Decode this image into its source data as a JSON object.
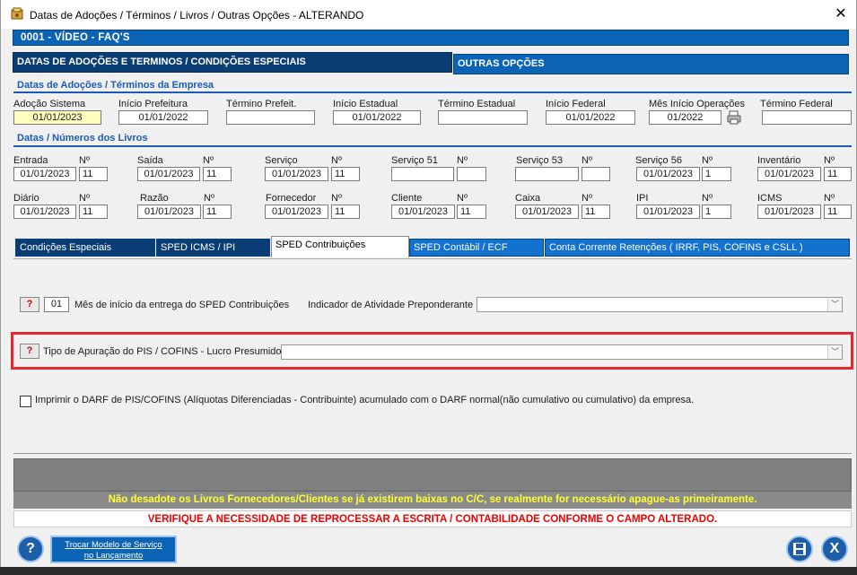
{
  "window": {
    "title": "Datas de Adoções / Términos / Livros / Outras Opções   -   ALTERANDO",
    "close": "✕"
  },
  "header": {
    "text": "0001   -   VÍDEO - FAQ'S"
  },
  "tabs": {
    "main_active": "DATAS DE ADOÇÕES E TERMINOS / CONDIÇÕES ESPECIAIS",
    "main_other": "OUTRAS OPÇÕES"
  },
  "section_dates": {
    "title": "Datas de Adoções / Términos da Empresa",
    "fields": [
      {
        "label": "Adoção Sistema",
        "value": "01/01/2023"
      },
      {
        "label": "Início Prefeitura",
        "value": "01/01/2022"
      },
      {
        "label": "Término Prefeit.",
        "value": ""
      },
      {
        "label": "Início Estadual",
        "value": "01/01/2022"
      },
      {
        "label": "Término Estadual",
        "value": ""
      },
      {
        "label": "Início Federal",
        "value": "01/01/2022"
      },
      {
        "label": "Mês Início Operações",
        "value": "01/2022"
      },
      {
        "label": "Término Federal",
        "value": ""
      }
    ]
  },
  "section_books": {
    "title": "Datas / Números dos Livros",
    "num_label": "Nº",
    "row1": [
      {
        "label": "Entrada",
        "date": "01/01/2023",
        "num": "11"
      },
      {
        "label": "Saída",
        "date": "01/01/2023",
        "num": "11"
      },
      {
        "label": "Serviço",
        "date": "01/01/2023",
        "num": "11"
      },
      {
        "label": "Serviço 51",
        "date": "",
        "num": ""
      },
      {
        "label": "Serviço 53",
        "date": "",
        "num": ""
      },
      {
        "label": "Serviço 56",
        "date": "01/01/2023",
        "num": "1"
      },
      {
        "label": "Inventário",
        "date": "01/01/2023",
        "num": "11"
      }
    ],
    "row2": [
      {
        "label": "Diário",
        "date": "01/01/2023",
        "num": "11"
      },
      {
        "label": "Razão",
        "date": "01/01/2023",
        "num": "11"
      },
      {
        "label": "Fornecedor",
        "date": "01/01/2023",
        "num": "11"
      },
      {
        "label": "Cliente",
        "date": "01/01/2023",
        "num": "11"
      },
      {
        "label": "Caixa",
        "date": "01/01/2023",
        "num": "11"
      },
      {
        "label": "IPI",
        "date": "01/01/2023",
        "num": "1"
      },
      {
        "label": "ICMS",
        "date": "01/01/2023",
        "num": "11"
      }
    ]
  },
  "subtabs": [
    "Condições Especiais",
    "SPED ICMS / IPI",
    "SPED Contribuições",
    "SPED Contábil / ECF",
    "Conta Corrente Retenções ( IRRF, PIS, COFINS  e  CSLL )"
  ],
  "sped": {
    "help": "?",
    "month_value": "01",
    "month_label": "Mês de início da entrega do SPED Contribuições",
    "indicador_label": "Indicador de Atividade Preponderante",
    "indicador_value": "",
    "tipo_label": "Tipo de Apuração do PIS / COFINS - Lucro Presumido:",
    "tipo_value": "",
    "checkbox_label": "Imprimir o DARF de PIS/COFINS (Alíquotas Diferenciadas - Contribuinte) acumulado com o DARF normal(não cumulativo ou cumulativo) da empresa."
  },
  "messages": {
    "yellow": "Não desadote os Livros Fornecedores/Clientes se já existirem baixas no C/C, se realmente for necessário apague-as primeiramente.",
    "red": "VERIFIQUE A NECESSIDADE DE REPROCESSAR A ESCRITA / CONTABILIDADE CONFORME O CAMPO ALTERADO."
  },
  "footer": {
    "help": "?",
    "trocar_line1": "Trocar Modelo de Serviço",
    "trocar_line2": "no Lançamento",
    "save": "💾",
    "exit": "X"
  },
  "colors": {
    "accent": "#0b63b6",
    "dark_tab": "#0a3d74",
    "highlight_border": "#e5282d",
    "section": "#1a5bb5"
  }
}
